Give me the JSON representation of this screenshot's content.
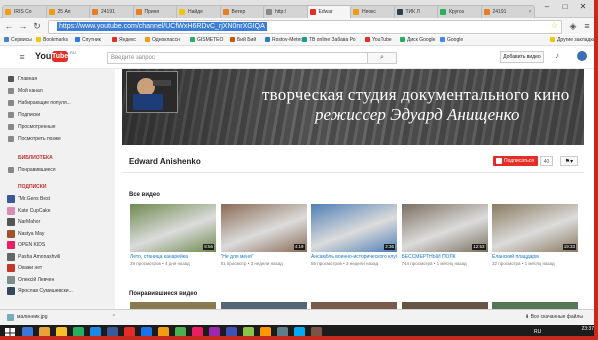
{
  "browser": {
    "tabs": [
      {
        "label": "IRIS Co",
        "color": "#f39c12"
      },
      {
        "label": "25 Ап",
        "color": "#f39c12"
      },
      {
        "label": "24191",
        "color": "#e67e22"
      },
      {
        "label": "Приня",
        "color": "#e67e22"
      },
      {
        "label": "Найде",
        "color": "#f1c40f"
      },
      {
        "label": "Ветер",
        "color": "#e67e22"
      },
      {
        "label": "http:/",
        "color": "#888888"
      },
      {
        "label": "Edwar",
        "color": "#e52d27"
      },
      {
        "label": "Неокс",
        "color": "#f39c12"
      },
      {
        "label": "ТИК Л",
        "color": "#2c3e50"
      },
      {
        "label": "Кругоз",
        "color": "#27ae60"
      },
      {
        "label": "24191",
        "color": "#e67e22"
      }
    ],
    "url": "https://www.youtube.com/channel/UCfWxH6RDvC_rjXN0nrXGIQA",
    "bookmarks": [
      "Сервисы",
      "Bookmarks",
      "Спутник",
      "Яндекс",
      "Одноклассн",
      "GISMETEO",
      "Бий Бий",
      "Rostov-Meteo",
      "TB online Забава Ро",
      "YouTube",
      "Диск Google",
      "Google",
      "Другие закладки"
    ]
  },
  "youtube": {
    "logo_text": "You",
    "logo_tube": "Tube",
    "logo_suffix": "RU",
    "search_placeholder": "Введите запрос",
    "add_video": "Добавить видео"
  },
  "sidebar": {
    "items": [
      "Главная",
      "Мой канал",
      "Набирающие популя...",
      "Подписки",
      "Просмотренные",
      "Посмотреть позже"
    ],
    "library_head": "БИБЛИОТЕКА",
    "library_items": [
      "Понравившиеся"
    ],
    "subs_head": "ПОДПИСКИ",
    "subs": [
      {
        "name": "\"Mr.Gens Best",
        "color": "#3b5998"
      },
      {
        "name": "Kate CupCake",
        "color": "#d98cb3"
      },
      {
        "name": "NarMahor",
        "color": "#555555"
      },
      {
        "name": "Nastya May",
        "color": "#a0522d"
      },
      {
        "name": "OPEN KIDS",
        "color": "#e91e63"
      },
      {
        "name": "Pasha Amonashvili",
        "color": "#666666"
      },
      {
        "name": "Окажи нет",
        "color": "#c0392b"
      },
      {
        "name": "Олексій Левчен",
        "color": "#7f8c8d"
      },
      {
        "name": "Ярослав Сумишевски...",
        "color": "#34495e"
      }
    ]
  },
  "channel": {
    "banner_line1": "творческая студия документального кино",
    "banner_line2": "режиссер Эдуард Анищенко",
    "name": "Edward Anishenko",
    "subscribe": "Подписаться",
    "sub_count": "40"
  },
  "sections": {
    "all_videos": "Все видео",
    "liked_videos": "Понравившиеся видео"
  },
  "videos": [
    {
      "title": "Лето, станица канарейка",
      "views": "29 просмотров",
      "age": "4 дня назад",
      "duration": "8:56",
      "tint": "#6f8a4e"
    },
    {
      "title": "\"Не для меня\"",
      "views": "81 просмотр",
      "age": "3 недели назад",
      "duration": "4:19",
      "tint": "#8a6b55"
    },
    {
      "title": "Ансамбль военно-исторического клуба \"Казачь...",
      "views": "56 просмотров",
      "age": "3 недели назад",
      "duration": "2:36",
      "tint": "#4f7fb5"
    },
    {
      "title": "БЕССМЕРТНЫЙ ПОЛК",
      "views": "744 просмотра",
      "age": "1 месяц назад",
      "duration": "12:53",
      "tint": "#7a7060"
    },
    {
      "title": "Еланский плацдарм",
      "views": "32 просмотра",
      "age": "1 месяц назад",
      "duration": "19:33",
      "tint": "#8a7a60"
    }
  ],
  "liked_thumbs": [
    "#8a7a50",
    "#556677",
    "#7a5a4a",
    "#665544",
    "#557755"
  ],
  "downloads": {
    "file": "малинник.jpg",
    "show_all": "Все скачанные файлы"
  },
  "taskbar": {
    "lang": "RU",
    "time": "23:37",
    "icons": [
      "#3c78d8",
      "#e8a33b",
      "#f7c02b",
      "#27ae60",
      "#1e88e5",
      "#3b5998",
      "#e52d27",
      "#1a73e8",
      "#f39c12",
      "#4caf50",
      "#e91e63",
      "#9c27b0",
      "#3f51b5",
      "#8bc34a",
      "#ff9800",
      "#607d8b",
      "#03a9f4",
      "#795548"
    ]
  }
}
